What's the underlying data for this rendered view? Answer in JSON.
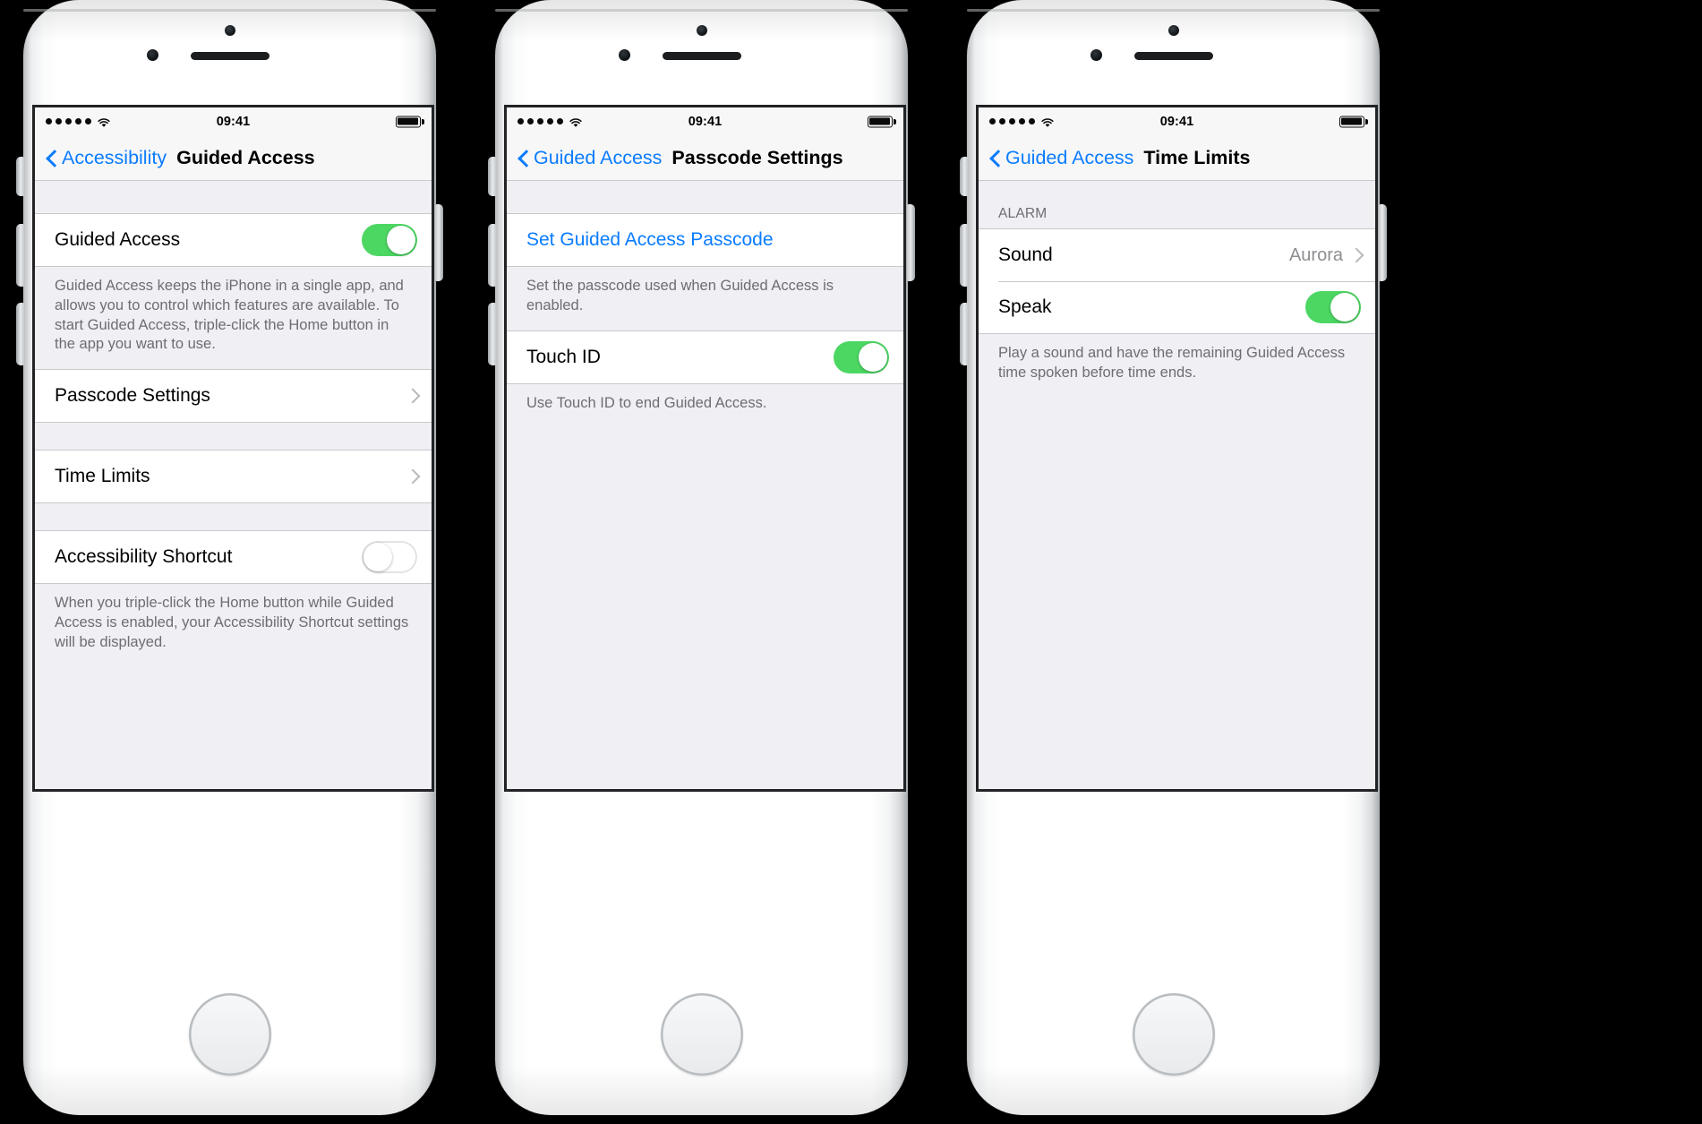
{
  "phones": [
    {
      "name": "guided-access",
      "status_bar": {
        "time": "09:41",
        "signal_dots": 5,
        "wifi": "wifi-icon",
        "battery": "battery-icon"
      },
      "nav": {
        "back_label": "Accessibility",
        "title": "Guided Access"
      },
      "sections": [
        {
          "rows": [
            {
              "type": "toggle",
              "label": "Guided Access",
              "state": "on"
            }
          ],
          "footer": "Guided Access keeps the iPhone in a single app, and allows you to control which features are available. To start Guided Access, triple-click the Home button in the app you want to use."
        },
        {
          "rows": [
            {
              "type": "disclosure",
              "label": "Passcode Settings"
            }
          ],
          "footer": ""
        },
        {
          "rows": [
            {
              "type": "disclosure",
              "label": "Time Limits"
            }
          ],
          "footer": ""
        },
        {
          "rows": [
            {
              "type": "toggle",
              "label": "Accessibility Shortcut",
              "state": "off"
            }
          ],
          "footer": "When you triple-click the Home button while Guided Access is enabled, your Accessibility Shortcut settings will be displayed."
        }
      ]
    },
    {
      "name": "passcode-settings",
      "status_bar": {
        "time": "09:41",
        "signal_dots": 5,
        "wifi": "wifi-icon",
        "battery": "battery-icon"
      },
      "nav": {
        "back_label": "Guided Access",
        "title": "Passcode Settings"
      },
      "sections": [
        {
          "rows": [
            {
              "type": "link",
              "label": "Set Guided Access Passcode"
            }
          ],
          "footer": "Set the passcode used when Guided Access is enabled."
        },
        {
          "rows": [
            {
              "type": "toggle",
              "label": "Touch ID",
              "state": "on"
            }
          ],
          "footer": "Use Touch ID to end Guided Access."
        }
      ]
    },
    {
      "name": "time-limits",
      "status_bar": {
        "time": "09:41",
        "signal_dots": 5,
        "wifi": "wifi-icon",
        "battery": "battery-icon"
      },
      "nav": {
        "back_label": "Guided Access",
        "title": "Time Limits"
      },
      "section_header": "ALARM",
      "sections": [
        {
          "rows": [
            {
              "type": "disclosure",
              "label": "Sound",
              "value": "Aurora"
            },
            {
              "type": "toggle",
              "label": "Speak",
              "state": "on"
            }
          ],
          "footer": "Play a sound and have the remaining Guided Access time spoken before time ends."
        }
      ]
    }
  ],
  "colors": {
    "accent_blue": "#0a7cff",
    "toggle_on_green": "#4cd763",
    "group_background": "#efeff4",
    "row_background": "#ffffff",
    "secondary_text": "#6d6d72",
    "value_text": "#8e8e93",
    "separator": "#c9c9cc"
  }
}
